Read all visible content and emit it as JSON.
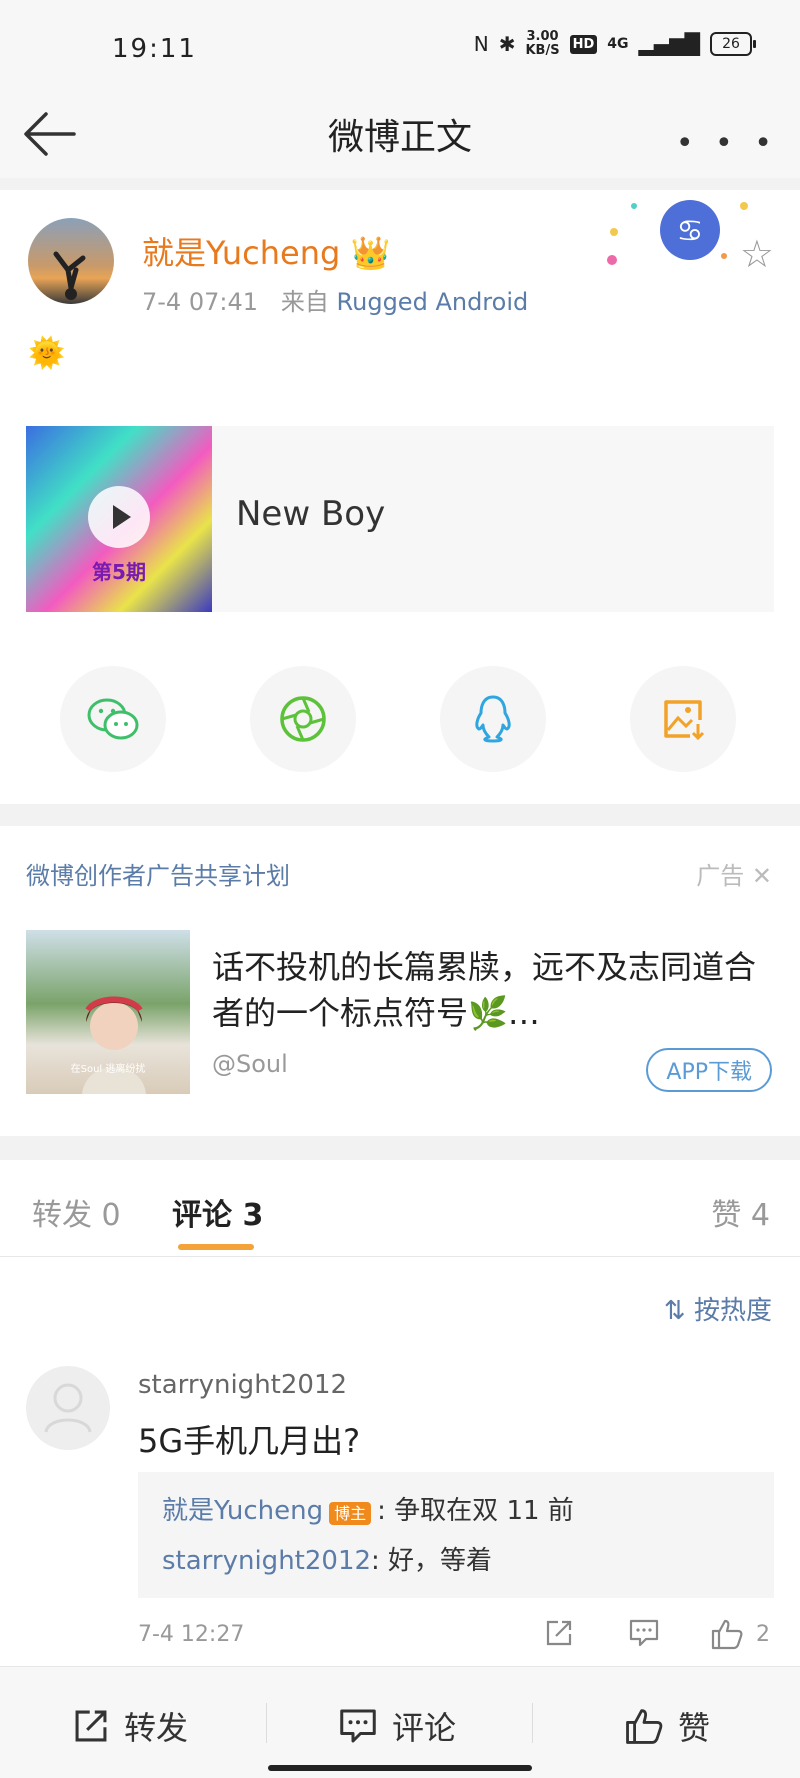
{
  "status_bar": {
    "time": "19:11",
    "net_speed_value": "3.00",
    "net_speed_unit": "KB/S",
    "hd": "HD",
    "signal": "4G",
    "battery": "26"
  },
  "nav": {
    "title": "微博正文"
  },
  "post": {
    "username": "就是Yucheng",
    "time": "7-4 07:41",
    "source_prefix": "来自",
    "source": "Rugged Android",
    "body_emoji": "🌞",
    "media": {
      "title": "New Boy",
      "thumb_caption": "第5期"
    },
    "share_icons": [
      "wechat-icon",
      "moments-icon",
      "qq-icon",
      "save-image-icon"
    ]
  },
  "ad": {
    "label": "微博创作者广告共享计划",
    "tag": "广告",
    "text": "话不投机的长篇累牍，远不及志同道合者的一个标点符号🌿…",
    "image_caption": "在Soul 逃离纷扰",
    "handle": "@Soul",
    "button": "APP下载"
  },
  "tabs": {
    "repost": "转发 0",
    "comment": "评论 3",
    "like": "赞 4"
  },
  "sort": {
    "label": "按热度"
  },
  "comment": {
    "user": "starrynight2012",
    "text": "5G手机几月出?",
    "replies": [
      {
        "user": "就是Yucheng",
        "badge": "博主",
        "text": ": 争取在双 11 前"
      },
      {
        "user": "starrynight2012",
        "text": ": 好，等着"
      }
    ],
    "time": "7-4 12:27",
    "likes": "2"
  },
  "bottom_bar": {
    "repost": "转发",
    "comment": "评论",
    "like": "赞"
  },
  "colors": {
    "accent": "#f3a33a",
    "username": "#e8791d",
    "link": "#5b7ca8"
  }
}
